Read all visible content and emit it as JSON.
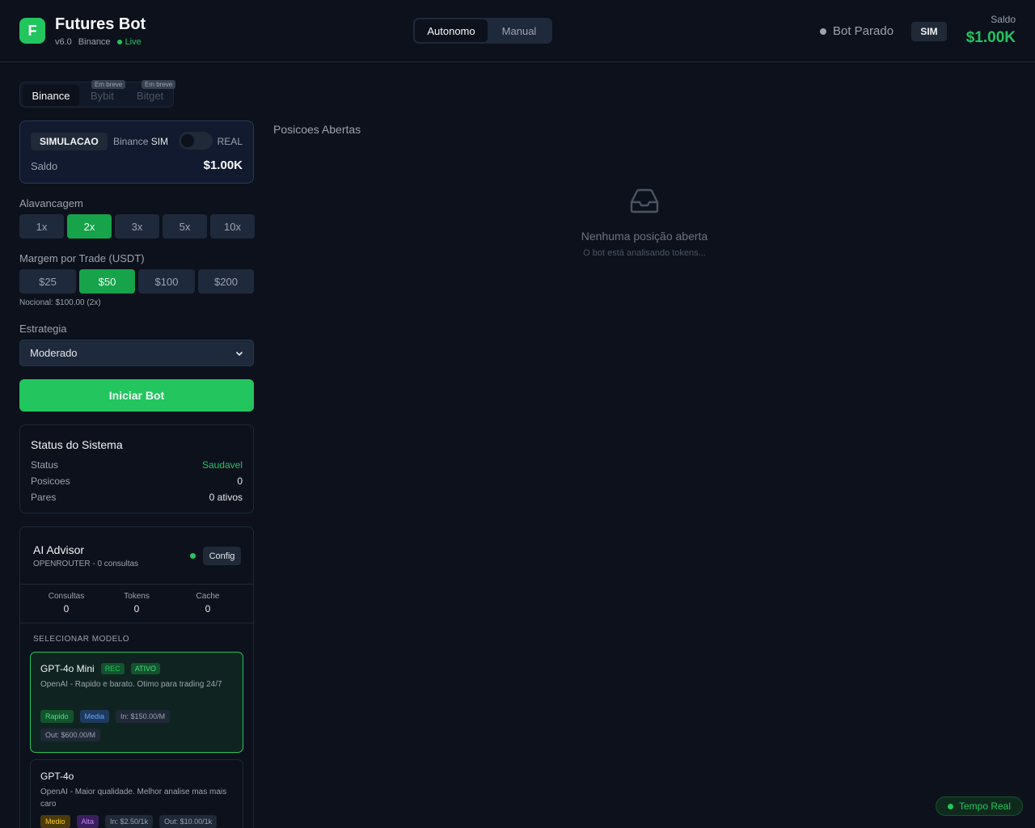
{
  "header": {
    "logo_letter": "F",
    "title": "Futures Bot",
    "version": "v6.0",
    "exchange": "Binance",
    "live": "Live",
    "modes": [
      "Autonomo",
      "Manual"
    ],
    "bot_status": "Bot Parado",
    "sim_badge": "SIM",
    "saldo_label": "Saldo",
    "saldo_value": "$1.00K"
  },
  "exchanges": {
    "active": "Binance",
    "others": [
      {
        "name": "Bybit",
        "badge": "Em breve"
      },
      {
        "name": "Bitget",
        "badge": "Em breve"
      }
    ]
  },
  "account": {
    "mode": "SIMULACAO",
    "exchange": "Binance",
    "sim": "SIM",
    "real": "REAL",
    "saldo_label": "Saldo",
    "saldo_value": "$1.00K"
  },
  "leverage": {
    "label": "Alavancagem",
    "options": [
      "1x",
      "2x",
      "3x",
      "5x",
      "10x"
    ],
    "selected": "2x"
  },
  "margin": {
    "label": "Margem por Trade (USDT)",
    "options": [
      "$25",
      "$50",
      "$100",
      "$200"
    ],
    "selected": "$50",
    "notional": "Nocional: $100.00 (2x)"
  },
  "strategy": {
    "label": "Estrategia",
    "value": "Moderado",
    "chevron": "chevron-down-icon"
  },
  "start_button": "Iniciar Bot",
  "system_status": {
    "title": "Status do Sistema",
    "rows": [
      {
        "label": "Status",
        "value": "Saudavel"
      },
      {
        "label": "Posicoes",
        "value": "0"
      },
      {
        "label": "Pares",
        "value": "0 ativos"
      }
    ]
  },
  "ai_advisor": {
    "title": "AI Advisor",
    "subtitle": "OPENROUTER - 0 consultas",
    "config": "Config",
    "stats": [
      {
        "label": "Consultas",
        "value": "0"
      },
      {
        "label": "Tokens",
        "value": "0"
      },
      {
        "label": "Cache",
        "value": "0"
      }
    ],
    "select_label": "SELECIONAR MODELO",
    "models": [
      {
        "name": "GPT-4o Mini",
        "tags": [
          "REC",
          "ATIVO"
        ],
        "desc": "OpenAI - Rapido e barato. Otimo para trading 24/7",
        "chips": [
          "Rapido",
          "Media",
          "In: $150.00/M",
          "Out: $600.00/M"
        ]
      },
      {
        "name": "GPT-4o",
        "desc": "OpenAI - Maior qualidade. Melhor analise mas mais caro",
        "chips": [
          "Medio",
          "Alta",
          "In: $2.50/1k",
          "Out: $10.00/1k"
        ]
      }
    ]
  },
  "main": {
    "title": "Posicoes Abertas",
    "empty_icon": "inbox-icon",
    "empty_title": "Nenhuma posição aberta",
    "empty_sub": "O bot está analisando tokens..."
  },
  "realtime": "Tempo Real",
  "colors": {
    "accent": "#22c55e",
    "background": "#0c111c",
    "panel": "#1e293b"
  }
}
